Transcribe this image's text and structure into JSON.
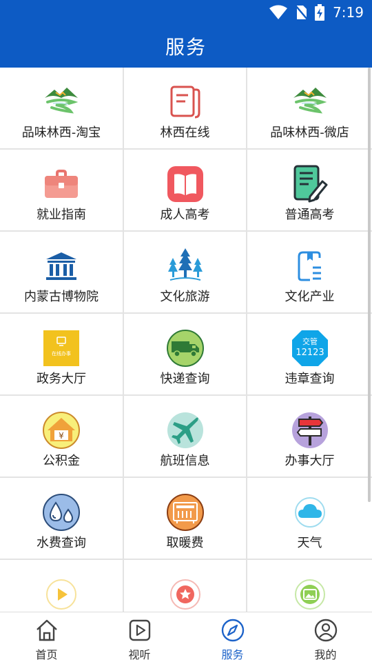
{
  "status_bar": {
    "time": "7:19"
  },
  "header": {
    "title": "服务"
  },
  "services": [
    {
      "label": "品味林西-淘宝",
      "icon": "mountain-river-logo-icon"
    },
    {
      "label": "林西在线",
      "icon": "document-icon"
    },
    {
      "label": "品味林西-微店",
      "icon": "mountain-river-logo-icon"
    },
    {
      "label": "就业指南",
      "icon": "briefcase-icon"
    },
    {
      "label": "成人高考",
      "icon": "open-book-icon"
    },
    {
      "label": "普通高考",
      "icon": "exam-paper-pen-icon"
    },
    {
      "label": "内蒙古博物院",
      "icon": "museum-icon"
    },
    {
      "label": "文化旅游",
      "icon": "pine-trees-icon"
    },
    {
      "label": "文化产业",
      "icon": "bookmark-list-icon"
    },
    {
      "label": "政务大厅",
      "icon": "online-affairs-icon",
      "icon_text": "在线办事"
    },
    {
      "label": "快递查询",
      "icon": "delivery-truck-icon"
    },
    {
      "label": "违章查询",
      "icon": "traffic-12123-icon",
      "icon_text_top": "交管",
      "icon_text_bottom": "12123"
    },
    {
      "label": "公积金",
      "icon": "housing-fund-icon",
      "icon_text": "¥"
    },
    {
      "label": "航班信息",
      "icon": "airplane-icon"
    },
    {
      "label": "办事大厅",
      "icon": "signpost-icon"
    },
    {
      "label": "水费查询",
      "icon": "water-drops-icon"
    },
    {
      "label": "取暖费",
      "icon": "heater-icon"
    },
    {
      "label": "天气",
      "icon": "cloud-icon"
    },
    {
      "label": "",
      "icon": "play-circle-icon"
    },
    {
      "label": "",
      "icon": "star-circle-icon"
    },
    {
      "label": "",
      "icon": "image-circle-icon"
    }
  ],
  "bottom_nav": [
    {
      "label": "首页",
      "icon": "home-icon"
    },
    {
      "label": "视听",
      "icon": "play-square-icon"
    },
    {
      "label": "服务",
      "icon": "compass-icon",
      "active": true
    },
    {
      "label": "我的",
      "icon": "user-circle-icon"
    }
  ],
  "colors": {
    "primary": "#0d5bc4",
    "nav_active": "#1d63c9"
  }
}
